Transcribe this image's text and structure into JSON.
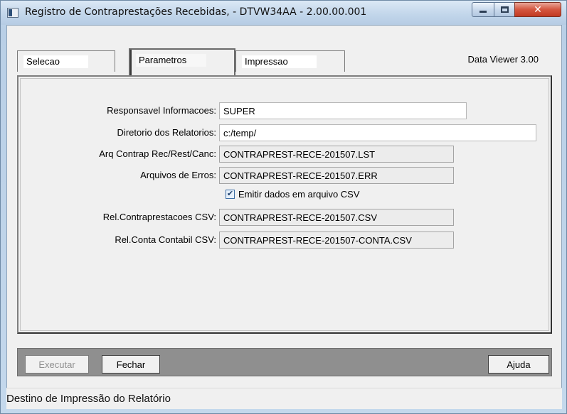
{
  "window": {
    "title": "Registro de Contraprestações Recebidas, - DTVW34AA - 2.00.00.001"
  },
  "tabs": [
    {
      "label": "Selecao",
      "active": false
    },
    {
      "label": "Parametros",
      "active": true
    },
    {
      "label": "Impressao",
      "active": false
    }
  ],
  "viewer_version": "Data Viewer 3.00",
  "form": {
    "responsavel": {
      "label": "Responsavel Informacoes:",
      "value": "SUPER"
    },
    "diretorio": {
      "label": "Diretorio dos Relatorios:",
      "value": "c:/temp/"
    },
    "arq_contrap": {
      "label": "Arq Contrap Rec/Rest/Canc:",
      "value": "CONTRAPREST-RECE-201507.LST"
    },
    "arq_erros": {
      "label": "Arquivos de Erros:",
      "value": "CONTRAPREST-RECE-201507.ERR"
    },
    "emitir_csv": {
      "label": "Emitir dados em arquivo CSV",
      "checked": true
    },
    "rel_contraprest_csv": {
      "label": "Rel.Contraprestacoes CSV:",
      "value": "CONTRAPREST-RECE-201507.CSV"
    },
    "rel_conta_csv": {
      "label": "Rel.Conta Contabil CSV:",
      "value": "CONTRAPREST-RECE-201507-CONTA.CSV"
    }
  },
  "buttons": {
    "executar": "Executar",
    "fechar": "Fechar",
    "ajuda": "Ajuda"
  },
  "status": "Destino de Impressão do Relatório"
}
